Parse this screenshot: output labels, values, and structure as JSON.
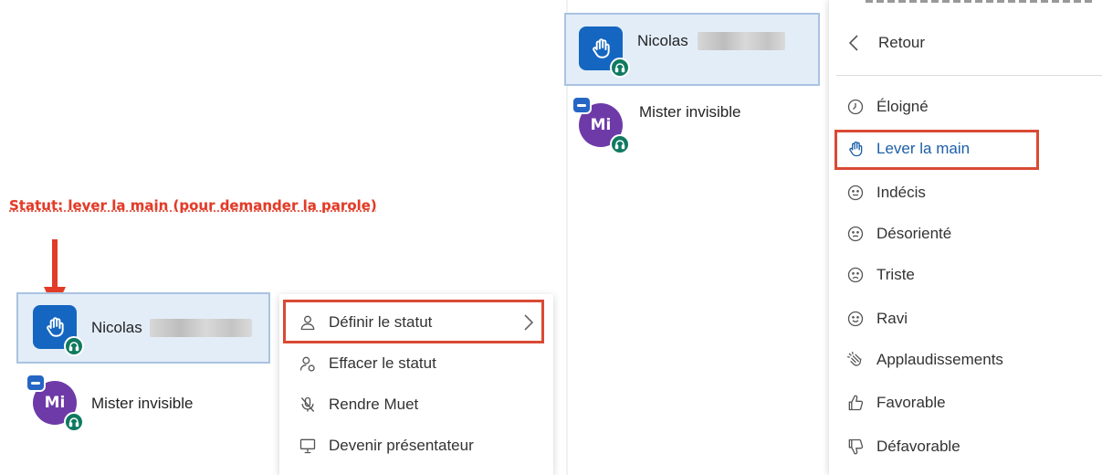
{
  "annotation": {
    "text": "Statut: lever la main (pour demander la parole)",
    "color": "#e23b28"
  },
  "left_panel": {
    "participants": [
      {
        "name": "Nicolas",
        "avatar_icon": "hand-icon",
        "status_icon": "headphones-icon",
        "selected": true
      },
      {
        "name": "Mister invisible",
        "initials": "Mi",
        "status_icon": "headphones-icon",
        "camera_badge": true
      }
    ],
    "context_menu": {
      "items": [
        {
          "label": "Définir le statut",
          "icon": "user-icon",
          "has_submenu": true,
          "highlighted": true
        },
        {
          "label": "Effacer le statut",
          "icon": "user-clear-icon"
        },
        {
          "label": "Rendre Muet",
          "icon": "mic-muted-icon"
        },
        {
          "label": "Devenir présentateur",
          "icon": "presentation-icon"
        }
      ]
    }
  },
  "right_panel": {
    "participants": [
      {
        "name": "Nicolas",
        "avatar_icon": "hand-icon",
        "status_icon": "headphones-icon",
        "selected": true
      },
      {
        "name": "Mister invisible",
        "initials": "Mi",
        "status_icon": "headphones-icon",
        "camera_badge": true
      }
    ],
    "status_menu": {
      "back_label": "Retour",
      "items": [
        {
          "label": "Éloigné",
          "icon": "clock-icon"
        },
        {
          "label": "Lever la main",
          "icon": "hand-icon",
          "highlighted": true,
          "color": "#1b5fa8"
        },
        {
          "label": "Indécis",
          "icon": "neutral-face-icon"
        },
        {
          "label": "Désorienté",
          "icon": "confused-face-icon"
        },
        {
          "label": "Triste",
          "icon": "sad-face-icon"
        },
        {
          "label": "Ravi",
          "icon": "happy-face-icon"
        },
        {
          "label": "Applaudissements",
          "icon": "clap-icon"
        },
        {
          "label": "Favorable",
          "icon": "thumbs-up-icon"
        },
        {
          "label": "Défavorable",
          "icon": "thumbs-down-icon"
        }
      ]
    }
  },
  "colors": {
    "accent_red": "#d94a34",
    "avatar_blue": "#1566c0",
    "avatar_purple": "#6e3aa8",
    "badge_green": "#0f7a60",
    "selected_bg": "#e3edf8"
  }
}
